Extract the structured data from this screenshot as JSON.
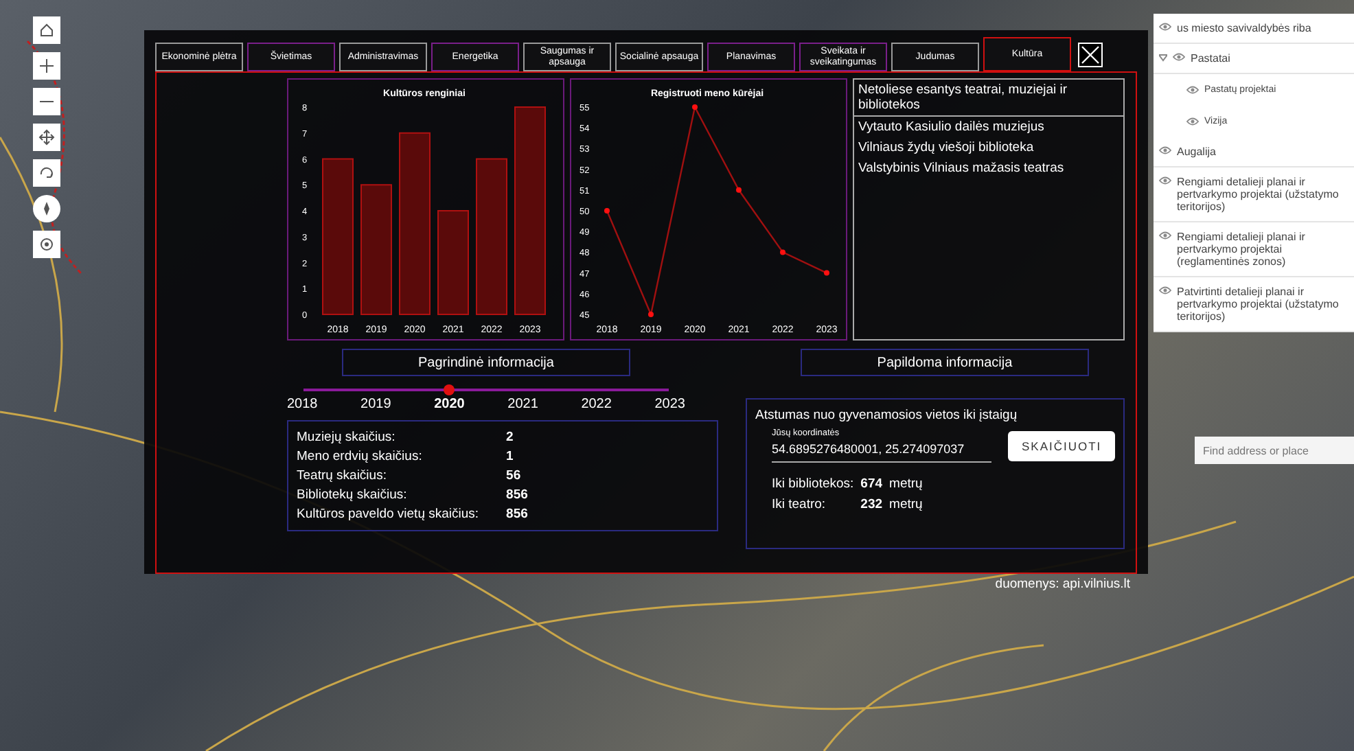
{
  "tabs": [
    {
      "label": "Ekonominė plėtra",
      "selected": false,
      "color": "#9a9a9a"
    },
    {
      "label": "Švietimas",
      "selected": false,
      "color": "#7a1f8a"
    },
    {
      "label": "Administravimas",
      "selected": false,
      "color": "#9a9a9a"
    },
    {
      "label": "Energetika",
      "selected": false,
      "color": "#7a1f8a"
    },
    {
      "label": "Saugumas ir apsauga",
      "selected": false,
      "color": "#9a9a9a"
    },
    {
      "label": "Socialinė apsauga",
      "selected": false,
      "color": "#9a9a9a"
    },
    {
      "label": "Planavimas",
      "selected": false,
      "color": "#7a1f8a"
    },
    {
      "label": "Sveikata ir sveikatingumas",
      "selected": false,
      "color": "#7a1f8a"
    },
    {
      "label": "Judumas",
      "selected": false,
      "color": "#9a9a9a"
    },
    {
      "label": "Kultūra",
      "selected": true,
      "color": "#d01010"
    }
  ],
  "charts": [
    {
      "chart_data": {
        "type": "bar",
        "title": "Kultūros renginiai",
        "categories": [
          "2018",
          "2019",
          "2020",
          "2021",
          "2022",
          "2023"
        ],
        "values": [
          6,
          5,
          7,
          4,
          6,
          8
        ],
        "ylim": [
          0,
          8
        ],
        "yticks": [
          0,
          1,
          2,
          3,
          4,
          5,
          6,
          7,
          8
        ]
      }
    },
    {
      "chart_data": {
        "type": "line",
        "title": "Registruoti meno kūrėjai",
        "categories": [
          "2018",
          "2019",
          "2020",
          "2021",
          "2022",
          "2023"
        ],
        "values": [
          50,
          45,
          55,
          51,
          48,
          47
        ],
        "marker": "circle",
        "ylim": [
          45,
          55
        ],
        "yticks": [
          45,
          46,
          47,
          48,
          49,
          50,
          51,
          52,
          53,
          54,
          55
        ]
      }
    }
  ],
  "nearby": {
    "title": "Netoliese esantys teatrai, muziejai ir bibliotekos",
    "items": [
      "Vytauto Kasiulio dailės muziejus",
      "Vilniaus žydų viešoji biblioteka",
      "Valstybinis Vilniaus mažasis teatras"
    ]
  },
  "section_buttons": [
    "Pagrindinė informacija",
    "Papildoma informacija"
  ],
  "years": [
    {
      "label": "2018",
      "selected": false
    },
    {
      "label": "2019",
      "selected": false
    },
    {
      "label": "2020",
      "selected": true
    },
    {
      "label": "2021",
      "selected": false
    },
    {
      "label": "2022",
      "selected": false
    },
    {
      "label": "2023",
      "selected": false
    }
  ],
  "stats": [
    {
      "label": "Muziejų skaičius:",
      "value": "2"
    },
    {
      "label": "Meno erdvių skaičius:",
      "value": "1"
    },
    {
      "label": "Teatrų skaičius:",
      "value": "56"
    },
    {
      "label": "Bibliotekų skaičius:",
      "value": "856"
    },
    {
      "label": "Kultūros paveldo vietų skaičius:",
      "value": "856"
    }
  ],
  "distance": {
    "title": "Atstumas nuo gyvenamosios vietos iki įstaigų",
    "field_label": "Jūsų koordinatės",
    "field_value": "54.6895276480001, 25.274097037",
    "button": "SKAIČIUOTI",
    "results": [
      {
        "label": "Iki bibliotekos:",
        "value": "674",
        "unit": "metrų"
      },
      {
        "label": "Iki teatro:",
        "value": "232",
        "unit": "metrų"
      }
    ]
  },
  "source": "duomenys: api.vilnius.lt",
  "layers": [
    {
      "label": "us miesto savivaldybės riba",
      "kind": "layer"
    },
    {
      "label": "Pastatai",
      "kind": "group",
      "expanded": true,
      "children": [
        {
          "label": "Pastatų projektai"
        },
        {
          "label": "Vizija"
        }
      ]
    },
    {
      "label": "Augalija",
      "kind": "layer"
    },
    {
      "label": "Rengiami detalieji planai ir pertvarkymo projektai (užstatymo teritorijos)",
      "kind": "layer"
    },
    {
      "label": "Rengiami detalieji planai ir pertvarkymo projektai (reglamentinės zonos)",
      "kind": "layer"
    },
    {
      "label": "Patvirtinti detalieji planai ir pertvarkymo projektai (užstatymo teritorijos)",
      "kind": "layer"
    }
  ],
  "search": {
    "placeholder": "Find address or place"
  }
}
